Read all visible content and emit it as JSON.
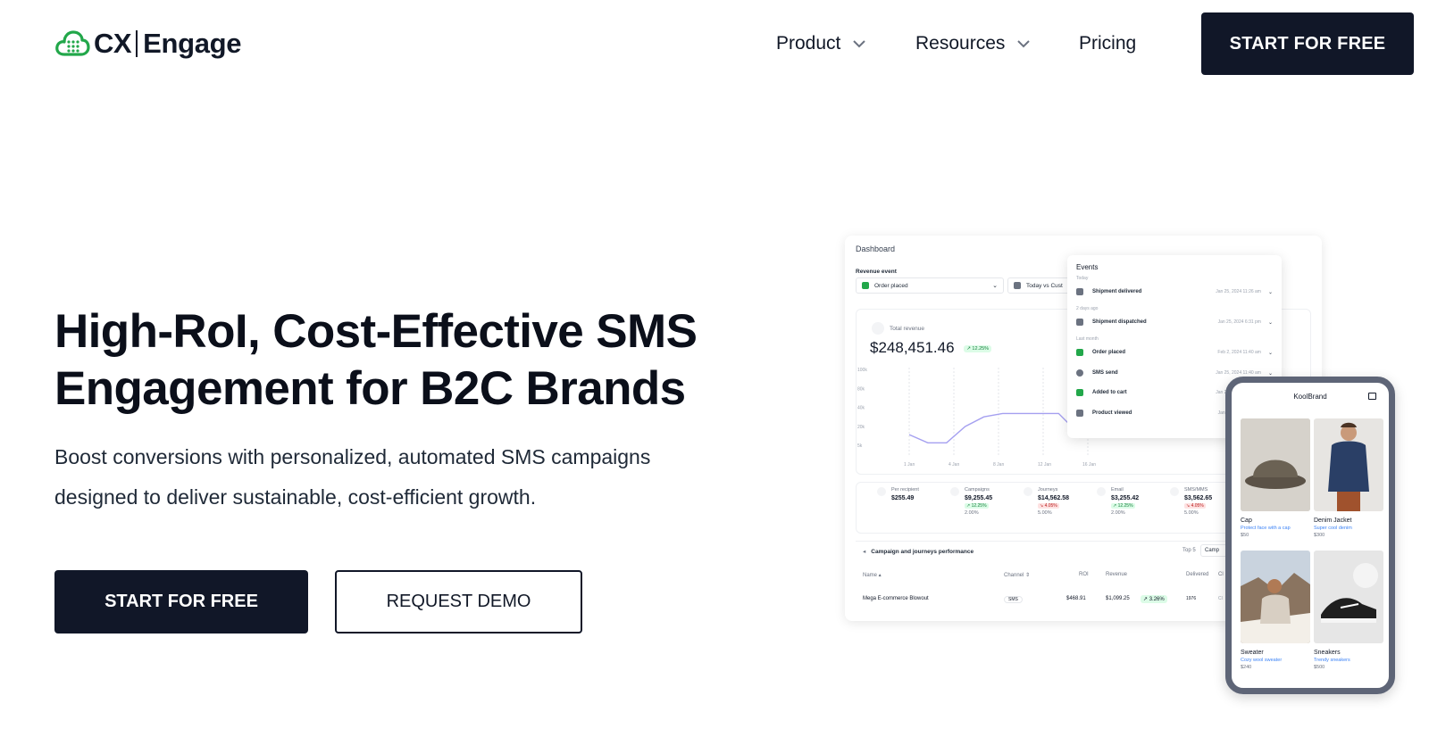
{
  "brand": {
    "name_cx": "CX",
    "name_engage": "Engage",
    "logo_icon": "cloud-grid-icon",
    "logo_color": "#22a74a"
  },
  "nav": {
    "items": [
      {
        "label": "Product",
        "has_dropdown": true
      },
      {
        "label": "Resources",
        "has_dropdown": true
      },
      {
        "label": "Pricing",
        "has_dropdown": false
      }
    ],
    "cta_label": "START FOR FREE"
  },
  "hero": {
    "title_line1": "High-RoI, Cost-Effective SMS",
    "title_line2": "Engagement for B2C Brands",
    "subtitle_line1": "Boost conversions with personalized, automated SMS campaigns",
    "subtitle_line2": "designed to deliver sustainable, cost-efficient growth.",
    "primary_cta": "START FOR FREE",
    "secondary_cta": "REQUEST DEMO"
  },
  "colors": {
    "dark": "#111728",
    "accent_green": "#22a74a",
    "chart_line": "#a5a0f0"
  },
  "dashboard": {
    "title": "Dashboard",
    "revenue_event_label": "Revenue event",
    "revenue_event_value": "Order placed",
    "date_filter": "Today vs Cust",
    "total_revenue_label": "Total revenue",
    "total_revenue_value": "$248,451.46",
    "total_revenue_change": "↗ 12.25%",
    "y_ticks": [
      "100k",
      "80k",
      "40k",
      "20k",
      "5k"
    ],
    "x_ticks": [
      "1 Jan",
      "4 Jan",
      "8 Jan",
      "12 Jan",
      "16 Jan",
      "20 Jan"
    ],
    "line_values": [
      0.35,
      0.18,
      0.18,
      0.52,
      0.72,
      0.79,
      0.79,
      0.79,
      0.79,
      0.4,
      0.4,
      0.6
    ],
    "stats": [
      {
        "label": "Per recipient",
        "value": "$255.49",
        "change": "",
        "pct": "",
        "dir": ""
      },
      {
        "label": "Campaigns",
        "value": "$9,255.45",
        "change": "↗ 12.25%",
        "pct": "2.00%",
        "dir": "up"
      },
      {
        "label": "Journeys",
        "value": "$14,562.58",
        "change": "↘ 4.05%",
        "pct": "5.00%",
        "dir": "down"
      },
      {
        "label": "Email",
        "value": "$3,255.42",
        "change": "↗ 12.25%",
        "pct": "2.00%",
        "dir": "up"
      },
      {
        "label": "SMS/MMS",
        "value": "$3,562.65",
        "change": "↘ 4.05%",
        "pct": "5.00%",
        "dir": "down"
      }
    ],
    "performance_title": "Campaign and journeys performance",
    "performance_top": "Top 5",
    "performance_tab": "Camp",
    "table_headers": [
      "Name ▴",
      "Channel ⇕",
      "ROI",
      "Revenue",
      "Delivered",
      "Cl"
    ],
    "table_row": {
      "name": "Mega E-commerce Blowout",
      "channel": "SMS",
      "roi": "$468.91",
      "revenue": "$1,099.25",
      "change": "↗ 3.26%",
      "delivered": "1976",
      "extra": "Cl"
    }
  },
  "events": {
    "title": "Events",
    "groups": [
      "Today",
      "2 days ago",
      "Last month"
    ],
    "rows": [
      {
        "name": "Shipment delivered",
        "date": "Jan 25, 2024  11:26 am",
        "icon": "message-icon"
      },
      {
        "name": "Shipment dispatched",
        "date": "Jan 25, 2024  6:31 pm",
        "icon": "message-icon"
      },
      {
        "name": "Order placed",
        "date": "Feb 2, 2024  11:40 am",
        "icon": "shopify-bag-icon"
      },
      {
        "name": "SMS send",
        "date": "Jan 25, 2024  11:40 am",
        "icon": "chat-bubble-icon"
      },
      {
        "name": "Added to cart",
        "date": "Jan 25, 2024  11:40 am",
        "icon": "shopify-bag-icon"
      },
      {
        "name": "Product viewed",
        "date": "Jan 25, 2024  9:12 am",
        "icon": "cursor-icon"
      }
    ]
  },
  "phone": {
    "brand": "KoolBrand",
    "products": [
      {
        "name": "Cap",
        "desc": "Protect face with a cap",
        "price": "$50"
      },
      {
        "name": "Denim Jacket",
        "desc": "Super cool denim",
        "price": "$300"
      },
      {
        "name": "Sweater",
        "desc": "Cozy wool sweater",
        "price": "$240"
      },
      {
        "name": "Sneakers",
        "desc": "Trendy sneakers",
        "price": "$500"
      }
    ]
  }
}
